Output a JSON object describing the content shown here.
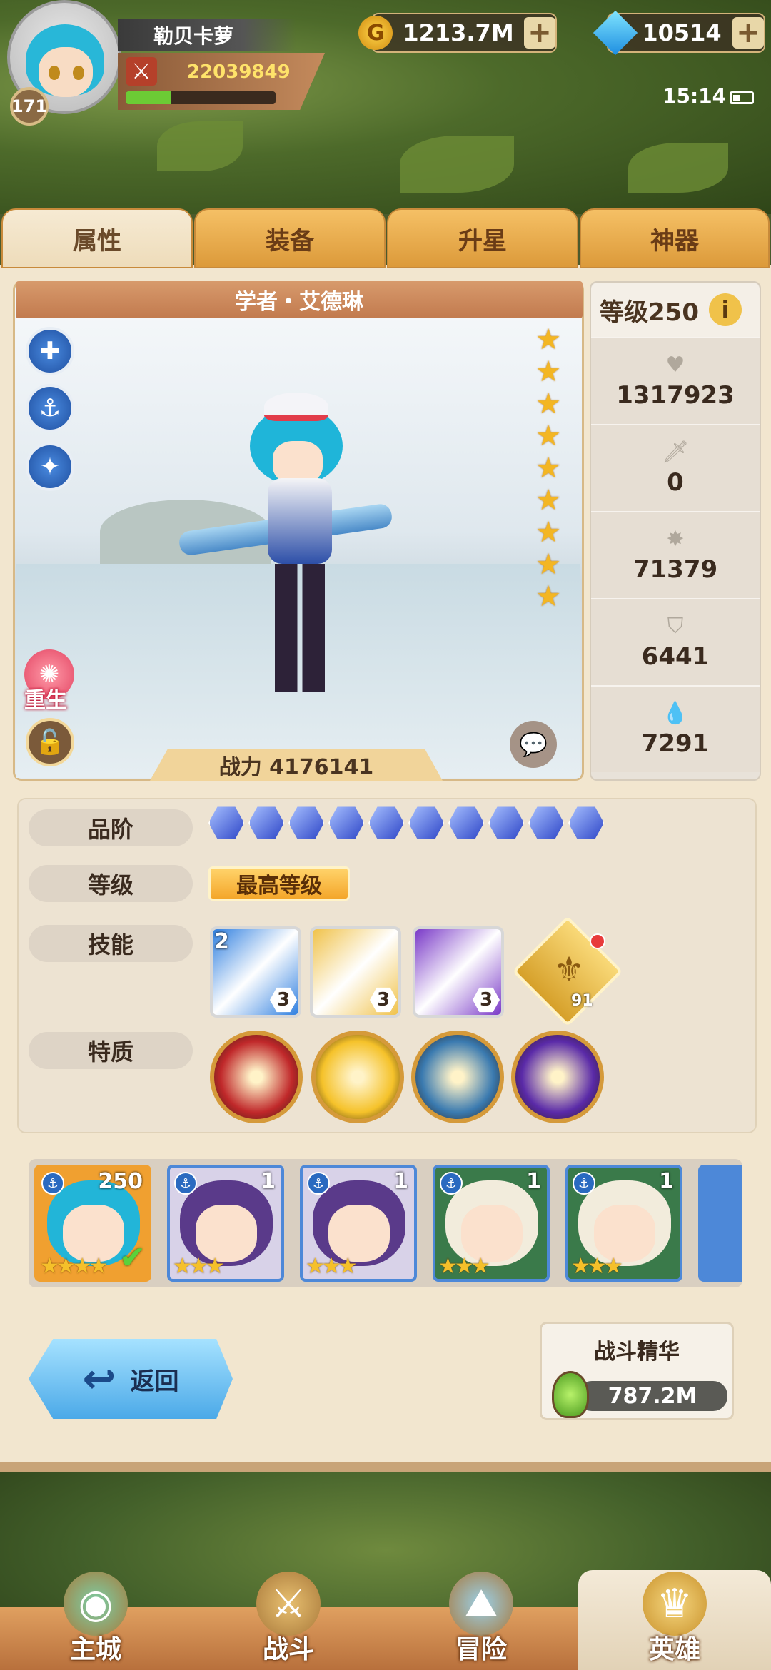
{
  "header": {
    "player_name": "勒贝卡萝",
    "player_level": "171",
    "power": "22039849",
    "exp_fraction": 0.3,
    "gold": "1213.7M",
    "gems": "10514",
    "time": "15:14"
  },
  "tabs": [
    {
      "label": "属性",
      "active": true
    },
    {
      "label": "装备",
      "active": false
    },
    {
      "label": "升星",
      "active": false
    },
    {
      "label": "神器",
      "active": false
    }
  ],
  "hero": {
    "title": "学者・艾德琳",
    "star_count": 9,
    "combat_power_label": "战力 4176141",
    "rebirth_label": "重生"
  },
  "stats": {
    "level_label": "等级250",
    "hp": "1317923",
    "attack": "0",
    "speed": "71379",
    "defense": "6441",
    "energy": "7291"
  },
  "details": {
    "grade_label": "品阶",
    "grade_count": 10,
    "level_label": "等级",
    "max_level_text": "最高等级",
    "skills_label": "技能",
    "skills": [
      {
        "level": "3",
        "count": "2",
        "color": "#2f7fe0"
      },
      {
        "level": "3",
        "count": "",
        "color": "#f0c24a"
      },
      {
        "level": "3",
        "count": "",
        "color": "#7a3ac8"
      }
    ],
    "emblem_level": "91",
    "traits_label": "特质",
    "traits": [
      "#c0282a",
      "#f5c22a",
      "#3a7ab0",
      "#5a2aa8"
    ]
  },
  "hero_list": [
    {
      "level": "250",
      "hair": "#22b5d8",
      "border": "#f0a030",
      "stars": "★★★★",
      "selected": true
    },
    {
      "level": "1",
      "hair": "#5a3a8a",
      "border": "#4d88d8",
      "stars": "★★★",
      "selected": false
    },
    {
      "level": "1",
      "hair": "#5a3a8a",
      "border": "#4d88d8",
      "stars": "★★★",
      "selected": false
    },
    {
      "level": "1",
      "hair": "#f2ecdc",
      "border": "#4d88d8",
      "stars": "★★★",
      "selected": false
    },
    {
      "level": "1",
      "hair": "#f2ecdc",
      "border": "#4d88d8",
      "stars": "★★★",
      "selected": false
    }
  ],
  "back_label": "返回",
  "essence": {
    "title": "战斗精华",
    "value": "787.2M"
  },
  "nav": [
    {
      "label": "主城",
      "active": false
    },
    {
      "label": "战斗",
      "active": false
    },
    {
      "label": "冒险",
      "active": false
    },
    {
      "label": "英雄",
      "active": true
    }
  ]
}
